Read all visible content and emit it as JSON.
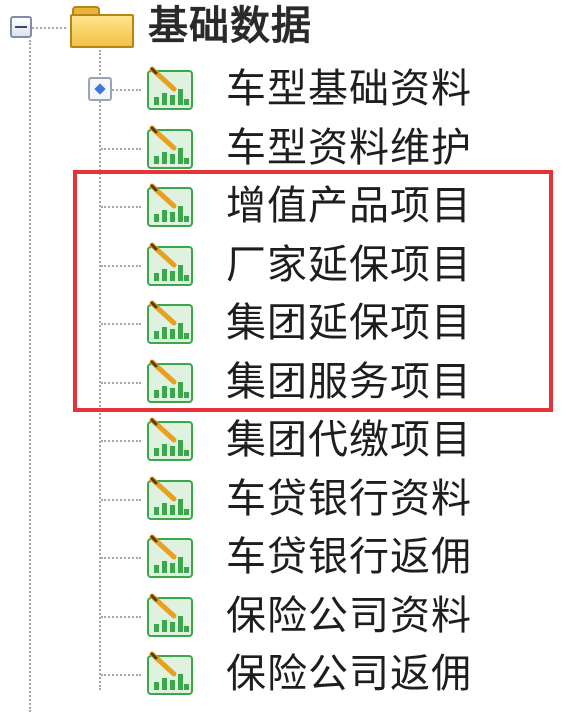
{
  "tree": {
    "root": {
      "label": "基础数据",
      "expanded": true,
      "icon": "folder-icon"
    },
    "items": [
      {
        "label": "车型基础资料",
        "icon": "report-chart-icon"
      },
      {
        "label": "车型资料维护",
        "icon": "report-chart-icon"
      },
      {
        "label": "增值产品项目",
        "icon": "report-chart-icon"
      },
      {
        "label": "厂家延保项目",
        "icon": "report-chart-icon"
      },
      {
        "label": "集团延保项目",
        "icon": "report-chart-icon"
      },
      {
        "label": "集团服务项目",
        "icon": "report-chart-icon"
      },
      {
        "label": "集团代缴项目",
        "icon": "report-chart-icon"
      },
      {
        "label": "车贷银行资料",
        "icon": "report-chart-icon"
      },
      {
        "label": "车贷银行返佣",
        "icon": "report-chart-icon"
      },
      {
        "label": "保险公司资料",
        "icon": "report-chart-icon"
      },
      {
        "label": "保险公司返佣",
        "icon": "report-chart-icon"
      }
    ]
  },
  "highlight": {
    "color": "#e8323a",
    "items_highlighted": [
      "增值产品项目",
      "厂家延保项目",
      "集团延保项目",
      "集团服务项目"
    ]
  },
  "colors": {
    "tree_line": "#a8a8a8",
    "icon_green": "#3aa84a",
    "icon_pencil": "#e8a020"
  }
}
